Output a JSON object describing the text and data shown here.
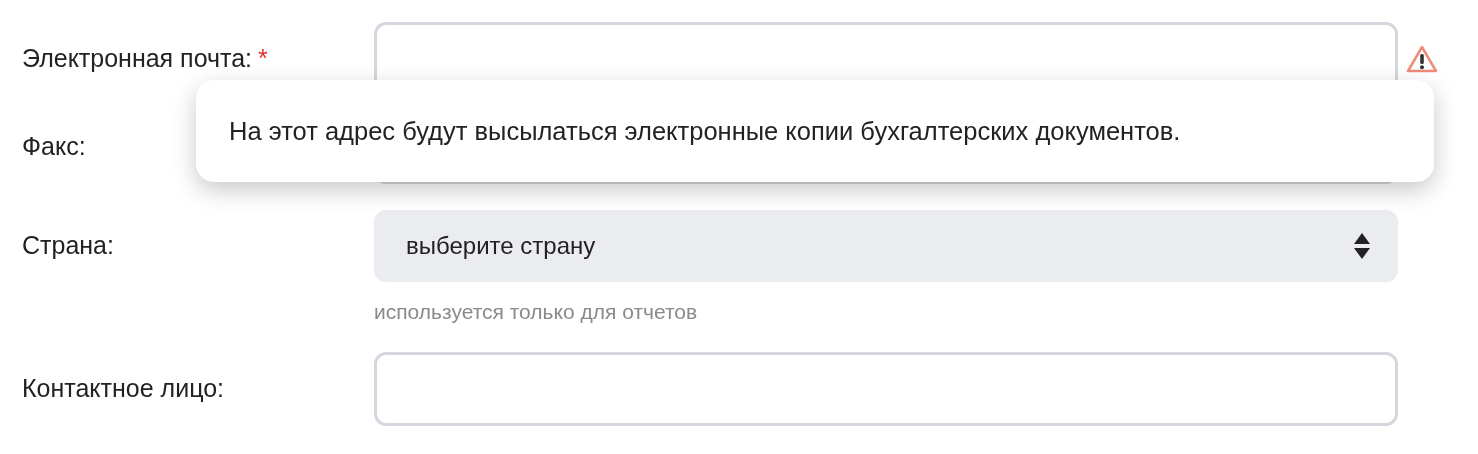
{
  "fields": [
    {
      "kind": "input",
      "label": "Электронная почта:",
      "required": true,
      "warning": true
    },
    {
      "kind": "input",
      "label": "Факс:",
      "required": false,
      "warning": false
    },
    {
      "kind": "select",
      "label": "Страна:",
      "required": false,
      "warning": false,
      "value": "выберите страну",
      "hint": "используется только для отчетов"
    },
    {
      "kind": "input",
      "label": "Контактное лицо:",
      "required": false,
      "warning": false
    }
  ],
  "required_symbol": "*",
  "tooltip": {
    "text": "На этот адрес будут высылаться электронные копии бухгалтерских документов."
  }
}
